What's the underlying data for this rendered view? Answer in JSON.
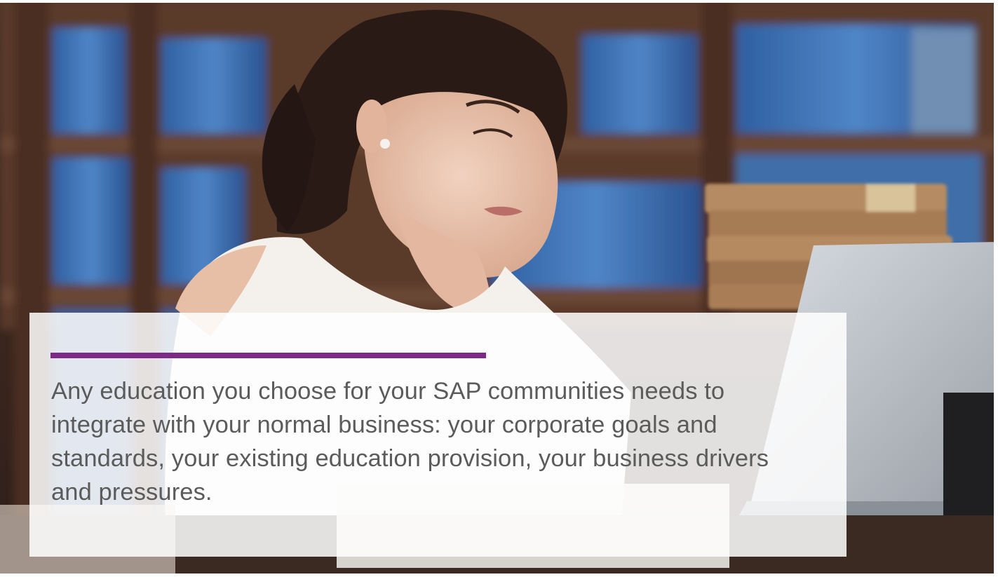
{
  "caption": {
    "text": "Any education you choose for your SAP communities needs to integrate with your normal business: your corporate goals and standards, your existing education provision, your business drivers and pressures."
  },
  "colors": {
    "accent_rule": "#7b2a86",
    "caption_text": "#5b5b5b",
    "panel": "#ffffff"
  },
  "hero": {
    "subject": "woman-studying-at-laptop-in-library"
  }
}
